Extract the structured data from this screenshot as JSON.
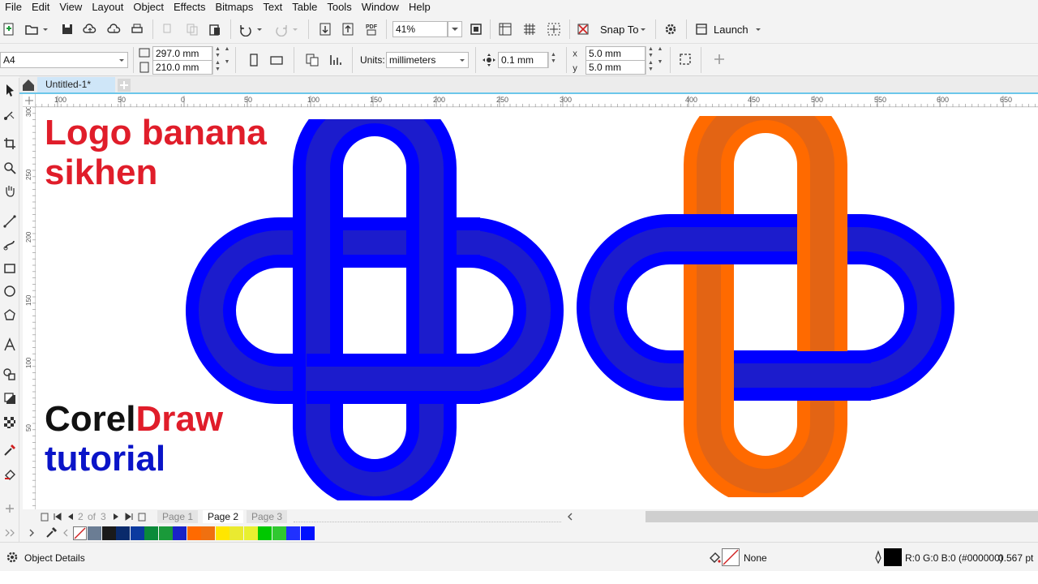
{
  "menu": [
    "File",
    "Edit",
    "View",
    "Layout",
    "Object",
    "Effects",
    "Bitmaps",
    "Text",
    "Table",
    "Tools",
    "Window",
    "Help"
  ],
  "toolbar": {
    "zoom": "41%",
    "snap_to": "Snap To",
    "launch": "Launch"
  },
  "props": {
    "page_size": "A4",
    "width": "297.0 mm",
    "height": "210.0 mm",
    "units_label": "Units:",
    "units_value": "millimeters",
    "nudge": "0.1 mm",
    "dup_x": "5.0 mm",
    "dup_y": "5.0 mm"
  },
  "document": {
    "tab_title": "Untitled-1*"
  },
  "ruler": {
    "h_ticks": [
      "100",
      "50",
      "0",
      "50",
      "100",
      "150",
      "200",
      "250",
      "300",
      "400",
      "450",
      "500",
      "550",
      "600",
      "650"
    ],
    "v_ticks": [
      "300",
      "250",
      "200",
      "150",
      "100",
      "50"
    ]
  },
  "canvas": {
    "title_line1": "Logo banana",
    "title_line2": "sikhen",
    "corel_part1": "Corel",
    "corel_part2": "Draw",
    "tutorial": "tutorial",
    "colors": {
      "red": "#e01d2a",
      "blue": "#0a14c8",
      "knot_blue_outer": "#0000ff",
      "knot_blue_inner": "#1c1ccc",
      "knot_orange_outer": "#ff6a00",
      "knot_orange_inner": "#e36414"
    }
  },
  "page_nav": {
    "current": "2",
    "of": "of",
    "total": "3",
    "pages": [
      "Page 1",
      "Page 2",
      "Page 3"
    ]
  },
  "palette": [
    "#6b7d94",
    "#1a1a1a",
    "#0a2a6b",
    "#0b3aa0",
    "#0a8a3a",
    "#1a9a3a",
    "#1a22c8",
    "#ff6a00",
    "#f07010",
    "#ffe600",
    "#eaea30",
    "#e8f030",
    "#00c800",
    "#30c830",
    "#2030ff",
    "#0010ff"
  ],
  "status": {
    "object_details": "Object Details",
    "fill_none": "None",
    "outline_info": "R:0 G:0 B:0 (#000000)",
    "outline_width": "0.567 pt"
  }
}
